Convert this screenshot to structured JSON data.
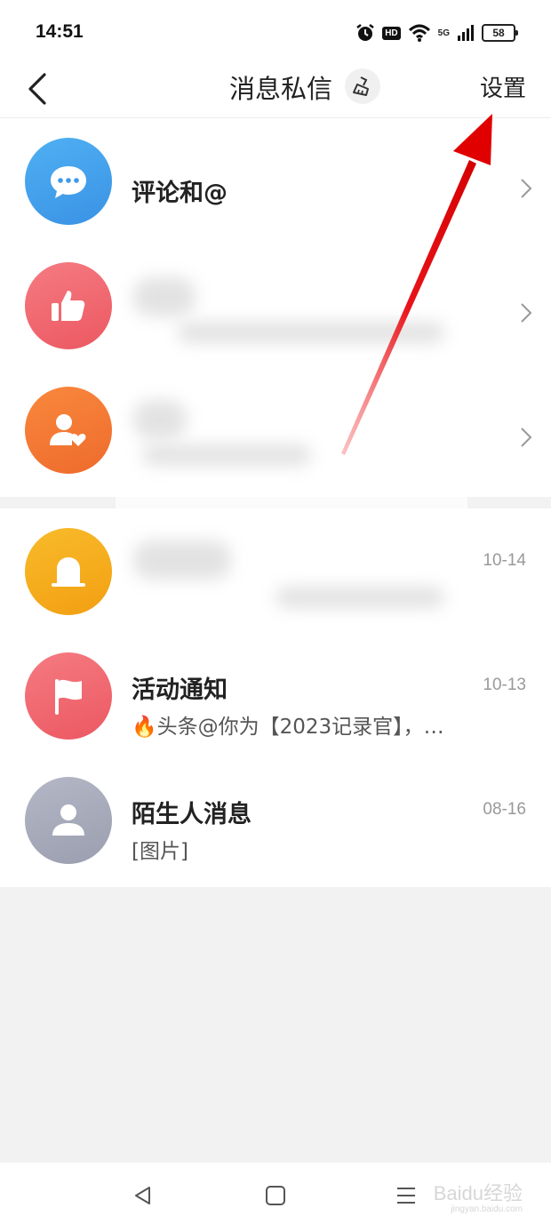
{
  "status_bar": {
    "time": "14:51",
    "hd": "HD",
    "network": "5G",
    "battery": "58",
    "icons": [
      "alarm-icon",
      "wifi-icon",
      "signal-icon",
      "battery-icon"
    ]
  },
  "header": {
    "title": "消息私信",
    "settings_label": "设置",
    "icons": [
      "back-icon",
      "brush-clean-icon"
    ]
  },
  "notification_rows": [
    {
      "title": "评论和@",
      "icon": "comment-bubble-icon",
      "color": "#3d9be9"
    },
    {
      "title": "",
      "icon": "thumbs-up-icon",
      "color": "#f0636b"
    },
    {
      "title": "",
      "icon": "fan-heart-icon",
      "color": "#f47a35"
    }
  ],
  "message_rows": [
    {
      "title": "",
      "subtitle": "",
      "date": "10-14",
      "icon": "bell-icon",
      "color": "#f6ad1c"
    },
    {
      "title": "活动通知",
      "subtitle": "🔥头条@你为【2023记录官】，…",
      "date": "10-13",
      "icon": "flag-icon",
      "color": "#f0636b"
    },
    {
      "title": "陌生人消息",
      "subtitle": "[图片]",
      "date": "08-16",
      "icon": "person-icon",
      "color": "#a8acbc"
    }
  ],
  "system_nav": {
    "icons": [
      "back-triangle-icon",
      "home-square-icon",
      "menu-lines-icon"
    ]
  },
  "watermark": {
    "text": "Baidu经验",
    "sub": "jingyan.baidu.com"
  }
}
